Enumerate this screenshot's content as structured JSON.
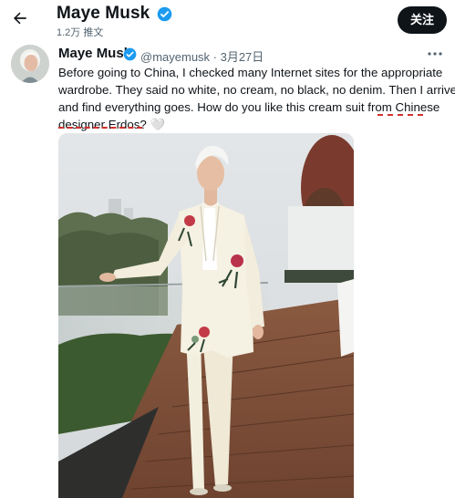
{
  "header": {
    "display_name": "Maye Musk",
    "post_count": "1.2万 推文",
    "follow_label": "关注"
  },
  "tweet": {
    "display_name": "Maye Musk",
    "handle_date": "@mayemusk · 3月27日",
    "text_lines": [
      "Before going to China, I checked many Internet sites for the appropriate",
      "wardrobe. They said no white, no cream, no black, no denim. Then I arrive",
      "and find everything goes. How do you like this cream suit from Chinese",
      "designer Erdos? 🤍"
    ]
  },
  "icons": {
    "back": "arrow-left-icon",
    "verified": "verified-badge-icon",
    "more": "more-horizontal-icon"
  },
  "colors": {
    "verified_blue": "#1d9bf0",
    "annotation_red": "#d0312d",
    "follow_bg": "#0f1419"
  }
}
